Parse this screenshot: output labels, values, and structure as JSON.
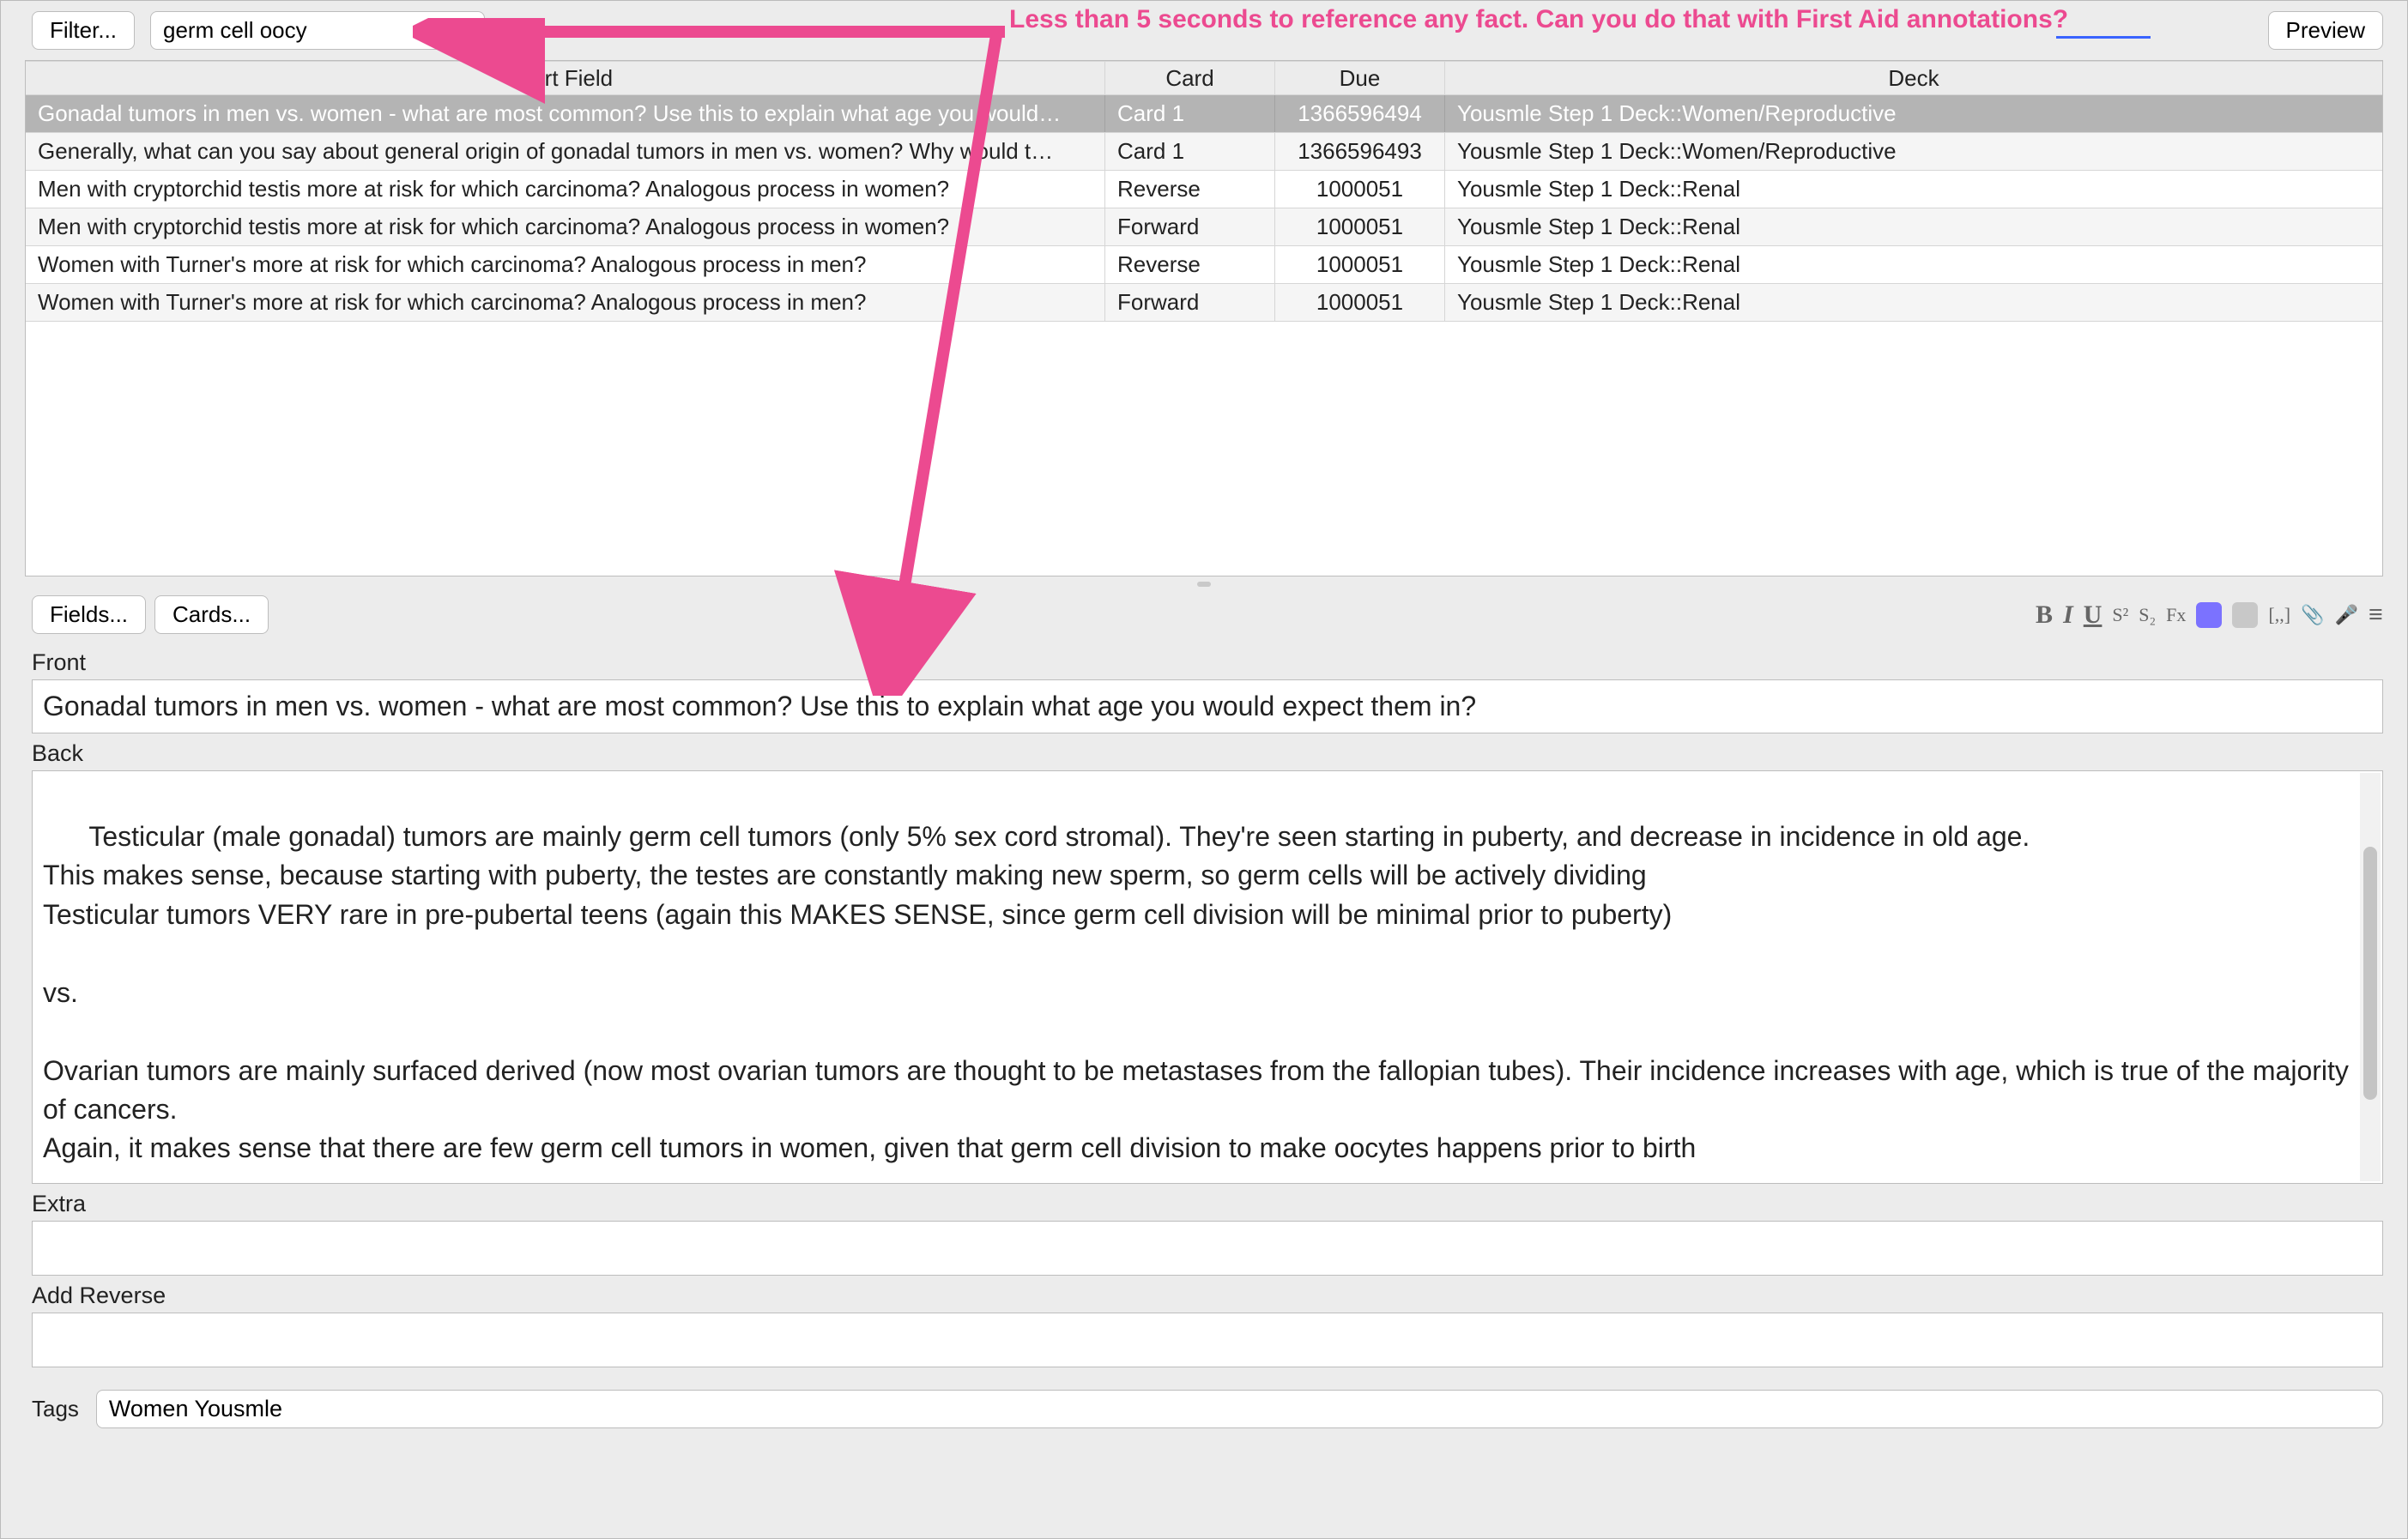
{
  "toolbar": {
    "filter_label": "Filter...",
    "search_value": "germ cell oocy",
    "preview_label": "Preview"
  },
  "annotation": {
    "text": "Less than 5 seconds to reference any fact. Can you do that with First Aid annotations?",
    "color": "#ec4a90"
  },
  "grid": {
    "headers": {
      "sort": "Sort Field",
      "card": "Card",
      "due": "Due",
      "deck": "Deck"
    },
    "rows": [
      {
        "selected": true,
        "sort": "Gonadal tumors in men vs. women - what are most common? Use this to explain what age you would…",
        "card": "Card 1",
        "due": "1366596494",
        "deck": "Yousmle Step 1 Deck::Women/Reproductive"
      },
      {
        "selected": false,
        "sort": "Generally, what can you say about general origin of gonadal tumors in men vs. women? Why would t…",
        "card": "Card 1",
        "due": "1366596493",
        "deck": "Yousmle Step 1 Deck::Women/Reproductive"
      },
      {
        "selected": false,
        "sort": "Men with cryptorchid testis more at risk for which carcinoma?  Analogous process in women?",
        "card": "Reverse",
        "due": "1000051",
        "deck": "Yousmle Step 1 Deck::Renal"
      },
      {
        "selected": false,
        "sort": "Men with cryptorchid testis more at risk for which carcinoma?  Analogous process in women?",
        "card": "Forward",
        "due": "1000051",
        "deck": "Yousmle Step 1 Deck::Renal"
      },
      {
        "selected": false,
        "sort": "Women with Turner's more at risk for which carcinoma?  Analogous process in men?",
        "card": "Reverse",
        "due": "1000051",
        "deck": "Yousmle Step 1 Deck::Renal"
      },
      {
        "selected": false,
        "sort": "Women with Turner's more at risk for which carcinoma?  Analogous process in men?",
        "card": "Forward",
        "due": "1000051",
        "deck": "Yousmle Step 1 Deck::Renal"
      }
    ]
  },
  "editbar": {
    "fields_label": "Fields...",
    "cards_label": "Cards..."
  },
  "icons": {
    "bold": "B",
    "italic": "I",
    "underline": "U",
    "superscript": "S²",
    "subscript": "S₂",
    "erase": "Fx",
    "fg_color": "#7b72ff",
    "bg_color": "#c8c8c8",
    "cloze": "[,,]",
    "attach": "📎",
    "mic": "🎤",
    "more": "≡"
  },
  "fields": {
    "front_label": "Front",
    "front_value": "Gonadal tumors in men vs. women - what are most common? Use this to explain what age you would expect them in?",
    "back_label": "Back",
    "back_value": "Testicular (male gonadal) tumors are mainly germ cell tumors (only 5% sex cord stromal). They're seen starting in puberty, and decrease in incidence in old age.\nThis makes sense, because starting with puberty, the testes are constantly making new sperm, so germ cells will be actively dividing\nTesticular tumors VERY rare in pre-pubertal teens (again this MAKES SENSE, since germ cell division will be minimal prior to puberty)\n\nvs.\n\nOvarian tumors are mainly surfaced derived (now most ovarian tumors are thought to be metastases from the fallopian tubes). Their incidence increases with age, which is true of the majority of cancers.\nAgain, it makes sense that there are few germ cell tumors in women, given that germ cell division to make oocytes happens prior to birth",
    "extra_label": "Extra",
    "extra_value": "",
    "addrev_label": "Add Reverse",
    "addrev_value": "",
    "tags_label": "Tags",
    "tags_value": "Women Yousmle"
  }
}
